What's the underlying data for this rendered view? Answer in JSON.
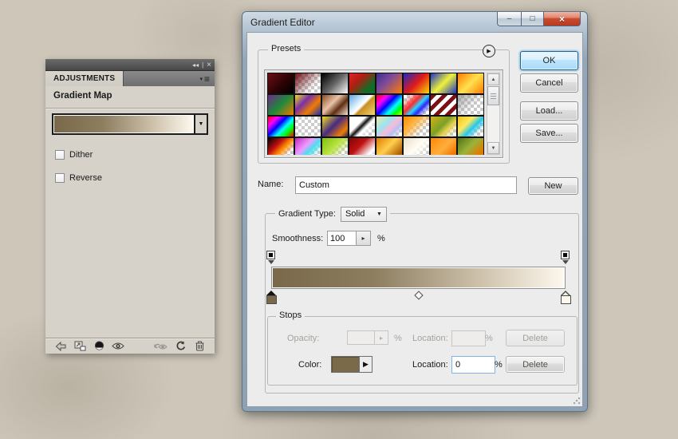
{
  "adjustments_panel": {
    "grip_icons": {
      "collapse": "◂◂",
      "separator": "|",
      "close": "×"
    },
    "tab_label": "ADJUSTMENTS",
    "menu_icon": {
      "arrow": "▾",
      "lines": "≡"
    },
    "title": "Gradient Map",
    "gradient_preview_css": "linear-gradient(90deg,#79694a 0%,#8d7e60 35%,#cfc3ad 72%,#fdf8ee 100%)",
    "preview_dropdown_arrow": "▼",
    "checkboxes": [
      {
        "label": "Dither",
        "checked": false
      },
      {
        "label": "Reverse",
        "checked": false
      }
    ],
    "footer_icons": [
      "back-arrow",
      "expanded-view",
      "clip-to-layer",
      "visibility",
      "previous-state",
      "reset",
      "delete"
    ]
  },
  "dialog": {
    "title": "Gradient Editor",
    "window_buttons": {
      "minimize": "–",
      "maximize": "□",
      "close": "×"
    },
    "presets": {
      "label": "Presets",
      "flyout_icon": "▶",
      "scrollbar": {
        "up": "▲",
        "down": "▼"
      },
      "swatches": [
        {
          "css": "linear-gradient(135deg,#6d0f14,#2a0305 55%,#000)",
          "transparent": false
        },
        {
          "css": "linear-gradient(135deg,rgba(109,15,20,1),rgba(109,15,20,0) 70%)",
          "transparent": true
        },
        {
          "css": "linear-gradient(135deg,#000,#666 50%,#fff)",
          "transparent": false
        },
        {
          "css": "linear-gradient(135deg,#e3202e,#b01e10 35%,#146b27 75%)",
          "transparent": false
        },
        {
          "css": "linear-gradient(135deg,#3f2d8c,#7c4a9b 40%,#ff7c00)",
          "transparent": false
        },
        {
          "css": "linear-gradient(135deg,#1b2bbf,#e01a1a 50%,#ffd800)",
          "transparent": false
        },
        {
          "css": "linear-gradient(135deg,#2033c4,#eef23a 50%,#2033c4)",
          "transparent": false
        },
        {
          "css": "linear-gradient(135deg,#ff7a00,#ffe14e 50%,#ff7a00)",
          "transparent": false
        },
        {
          "css": "linear-gradient(135deg,#6d2a8a,#1f8a3a 50%,#f57900)",
          "transparent": false
        },
        {
          "css": "linear-gradient(135deg,#f2df1f,#7a2fa8 35%,#ef7d00 65%,#1c2fae)",
          "transparent": false
        },
        {
          "css": "linear-gradient(135deg,#8a4a26,#e8c3a6 40%,#5e2e12 65%,#f6e7d6)",
          "transparent": false
        },
        {
          "css": "linear-gradient(135deg,#5aa7dd,#eaf6ff 42%,#fff 50%,#c89020 58%,#f3d87e)",
          "transparent": false
        },
        {
          "css": "linear-gradient(135deg,#f00,#f0f 25%,#00f 45%,#0ff 65%,#0f0 82%,#cf0)",
          "transparent": false
        },
        {
          "css": "linear-gradient(135deg,rgba(255,255,255,0) 12%,#ff2a2a 38%,#2ad4ff 55%,#2a2aff 68%,rgba(255,255,255,0) 88%)",
          "transparent": true
        },
        {
          "css": "repeating-linear-gradient(135deg,#7c1016 0 5px,#fff 5px 10px)",
          "transparent": false
        },
        {
          "css": "linear-gradient(135deg,rgba(150,150,150,.85),rgba(150,150,150,0) 60%)",
          "transparent": true
        },
        {
          "css": "linear-gradient(135deg,#f00,#f0f 22%,#00f 42%,#0ff 60%,#0f0 78%,#f00)",
          "transparent": false
        },
        {
          "css": "linear-gradient(135deg,rgba(255,255,255,.12),rgba(255,255,255,0))",
          "transparent": true
        },
        {
          "css": "linear-gradient(135deg,#f2df1f,#472a83 45%,#ef7d00 80%,#20255e)",
          "transparent": false
        },
        {
          "css": "linear-gradient(135deg,#fff 36%,#111 48%,#fff 60%,rgba(255,255,255,0) 82%)",
          "transparent": true
        },
        {
          "css": "linear-gradient(135deg,#f7e6a8,#9ae6ef 35%,#f6bcd8 55%,#b9c0f2 72%,rgba(255,255,255,0) 90%)",
          "transparent": true
        },
        {
          "css": "linear-gradient(135deg,#ff8a00,#ffb340 35%,rgba(255,179,64,0) 72%)",
          "transparent": true
        },
        {
          "css": "linear-gradient(135deg,#d8b018,#7aa024 45%,#e8d253 65%,rgba(232,210,83,0) 88%)",
          "transparent": true
        },
        {
          "css": "linear-gradient(135deg,#f4c21a,#ffe95e 35%,#25c8e8 58%,rgba(255,255,255,0) 82%)",
          "transparent": true
        },
        {
          "css": "linear-gradient(135deg,#000,#c01010 35%,#ff8a00 55%,rgba(255,138,0,0) 80%)",
          "transparent": true
        },
        {
          "css": "linear-gradient(135deg,#c227c2,#f09aff 40%,#49dff0 60%,rgba(255,255,255,0) 85%)",
          "transparent": true
        },
        {
          "css": "linear-gradient(135deg,#7fbf18,#b8e23c 45%,rgba(184,226,60,0) 80%)",
          "transparent": true
        },
        {
          "css": "linear-gradient(135deg,#7e0606,#c01212 40%,#fff 78%,rgba(255,255,255,0) 95%)",
          "transparent": true
        },
        {
          "css": "linear-gradient(135deg,#e07c00,#ffcf4e 45%,#b06000 85%)",
          "transparent": false
        },
        {
          "css": "linear-gradient(135deg,#e8e0c8,#fffdf4 50%,rgba(255,255,255,0) 88%)",
          "transparent": true
        },
        {
          "css": "linear-gradient(135deg,#ff8a00,#ffae3e 50%,#f07800 85%)",
          "transparent": false
        },
        {
          "css": "linear-gradient(135deg,#547012,#9ab33a 45%,#e07b00 82%)",
          "transparent": false
        }
      ]
    },
    "buttons": {
      "ok": "OK",
      "cancel": "Cancel",
      "load": "Load...",
      "save": "Save...",
      "new": "New"
    },
    "name_row": {
      "label": "Name:",
      "value": "Custom"
    },
    "gradient_type": {
      "label": "Gradient Type:",
      "value": "Solid",
      "arrow": "▼"
    },
    "smoothness": {
      "label": "Smoothness:",
      "value": "100",
      "unit": "%",
      "spinner_arrow": "▸"
    },
    "gradient_bar": {
      "css": "linear-gradient(90deg,#79694a 0%,#8d7e60 35%,#cfc3ad 72%,#fdf8ee 100%)",
      "left_stop_color": "#79694a",
      "right_stop_color": "#fdf8ee",
      "midpoint_percent": 50
    },
    "stops": {
      "label": "Stops",
      "opacity_row": {
        "opacity_label": "Opacity:",
        "opacity_value": "",
        "opacity_unit": "%",
        "location_label": "Location:",
        "location_value": "",
        "location_unit": "%",
        "delete_label": "Delete",
        "spinner_arrow": "▸"
      },
      "color_row": {
        "color_label": "Color:",
        "swatch_color": "#7a6a4a",
        "swatch_arrow": "▶",
        "location_label": "Location:",
        "location_value": "0",
        "location_unit": "%",
        "delete_label": "Delete"
      }
    }
  }
}
